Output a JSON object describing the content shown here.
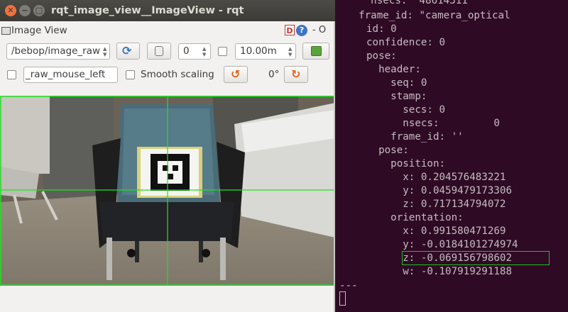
{
  "window": {
    "title": "rqt_image_view__ImageView - rqt",
    "plugin_title": "Image View",
    "help_icon_text": "D",
    "undock_text": "- O"
  },
  "toolbar": {
    "topic": "/bebop/image_raw",
    "rotation_spin": "0",
    "timeout": "10.00m",
    "mouse_topic": "_raw_mouse_left",
    "smooth_scaling_label": "Smooth scaling",
    "rotation_label": "0°"
  },
  "terminal": {
    "lines": [
      "    nsecs:  48614311",
      "  frame_id: \"camera_optical",
      "id: 0",
      "confidence: 0",
      "pose:",
      "  header:",
      "    seq: 0",
      "    stamp:",
      "      secs: 0",
      "      nsecs:         0",
      "    frame_id: ''",
      "  pose:",
      "    position:",
      "      x: 0.204576483221",
      "      y: 0.0459479173306",
      "      z: 0.717134794072",
      "    orientation:",
      "      x: 0.991580471269",
      "      y: -0.0184101274974",
      "      z: -0.069156798602",
      "      w: -0.107919291188",
      "---"
    ],
    "highlighted_line": 19
  },
  "colors": {
    "terminal_bg": "#2f0a25",
    "terminal_text": "#c4bcc0",
    "highlight": "#1ac41a",
    "titlebar": "#3c3b37",
    "close_button": "#f0713f",
    "crosshair": "#22e022"
  }
}
